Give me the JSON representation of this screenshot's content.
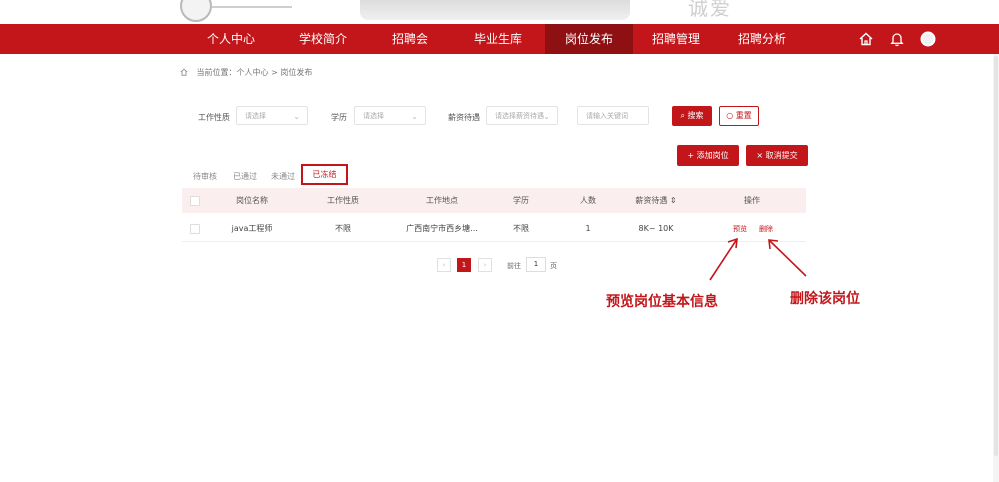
{
  "banner": {
    "motto": "诚爱"
  },
  "nav": {
    "items": [
      "个人中心",
      "学校简介",
      "招聘会",
      "毕业生库",
      "岗位发布",
      "招聘管理",
      "招聘分析"
    ],
    "active": "岗位发布",
    "icons": [
      "home-icon",
      "bell-icon",
      "avatar"
    ]
  },
  "breadcrumb": {
    "prefix": "当前位置：",
    "path": "个人中心 > 岗位发布"
  },
  "filters": {
    "job_type_label": "工作性质",
    "job_type_placeholder": "请选择",
    "education_label": "学历",
    "education_placeholder": "请选择",
    "salary_label": "薪资待遇",
    "salary_placeholder": "请选择薪资待遇",
    "keyword_placeholder": "请输入关键词",
    "search_label": "搜索",
    "reset_label": "重置"
  },
  "actions": {
    "add_label": "添加岗位",
    "cancel_label": "取消提交"
  },
  "tabs": [
    "待审核",
    "已通过",
    "未通过",
    "已冻结"
  ],
  "active_tab": "已冻结",
  "table": {
    "headers": [
      "岗位名称",
      "工作性质",
      "工作地点",
      "学历",
      "人数",
      "薪资待遇",
      "操作"
    ],
    "sort_indicator": "⇕",
    "rows": [
      {
        "name": "java工程师",
        "type": "不限",
        "location": "广西南宁市西乡塘...",
        "education": "不限",
        "count": "1",
        "salary": "8K~ 10K",
        "preview": "预览",
        "delete": "删除"
      }
    ]
  },
  "pagination": {
    "prev": "‹",
    "current": "1",
    "next": "›",
    "goto_prefix": "前往",
    "goto_value": "1",
    "goto_suffix": "页"
  },
  "annotations": {
    "preview_note": "预览岗位基本信息",
    "delete_note": "删除该岗位"
  },
  "colors": {
    "primary": "#c3161b",
    "active_nav": "#8f1013",
    "table_header": "#fbeeee"
  }
}
